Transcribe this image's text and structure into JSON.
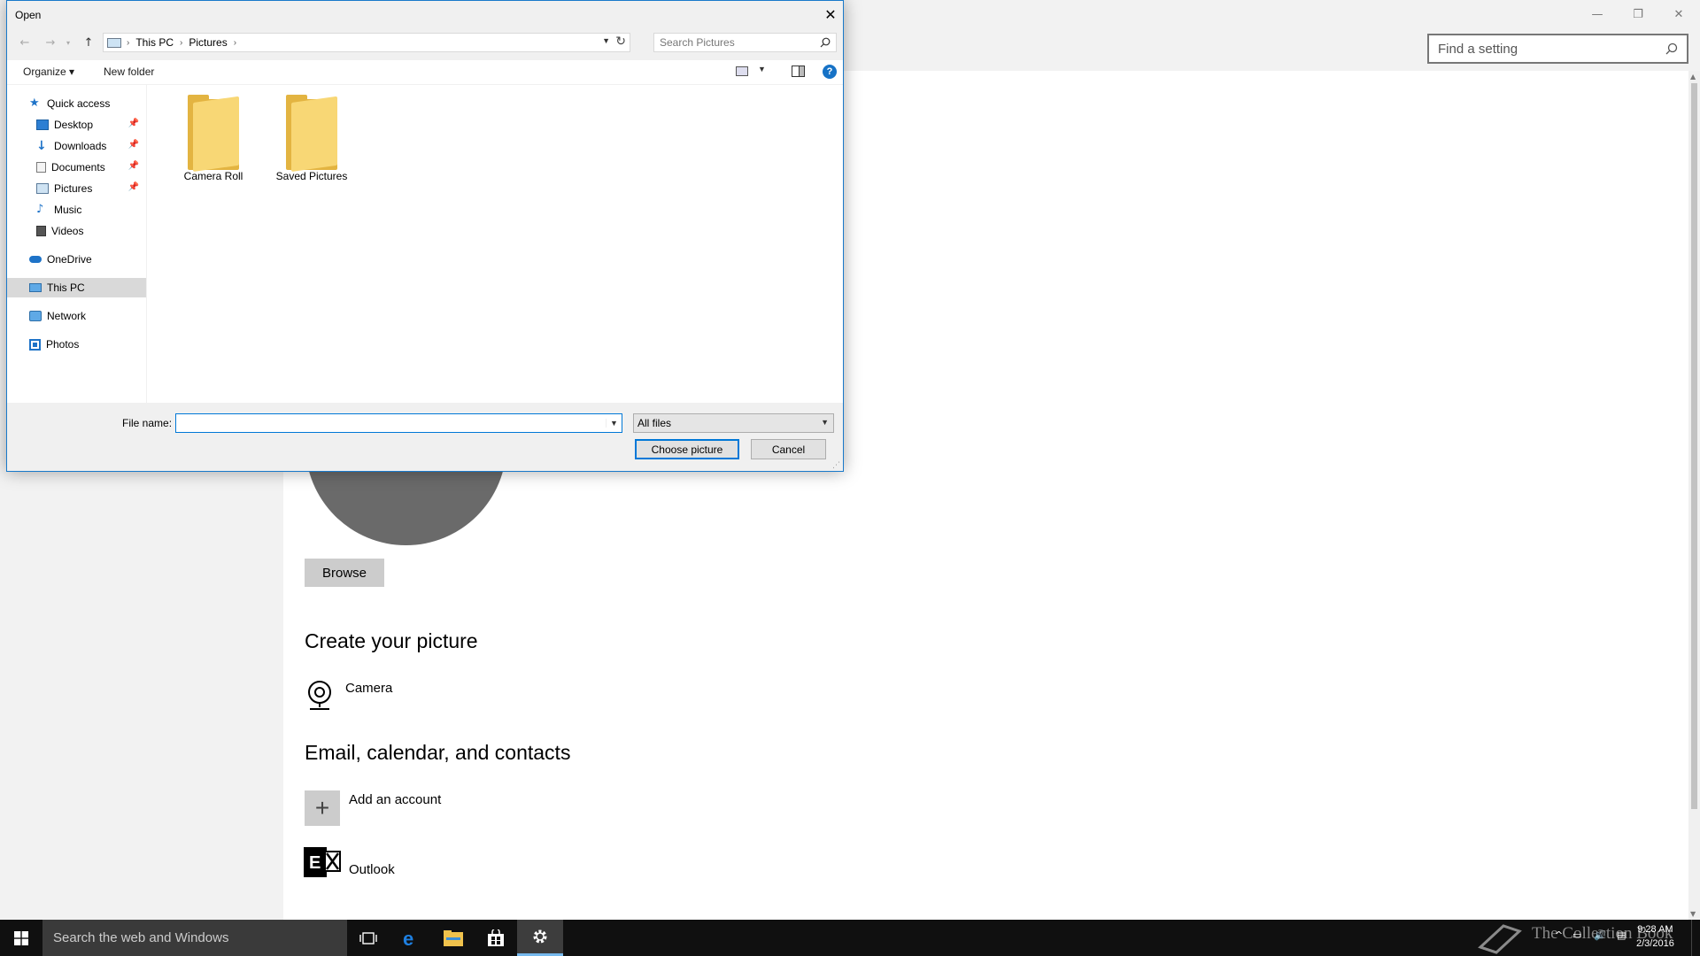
{
  "settings": {
    "search_placeholder": "Find a setting",
    "window_controls": {
      "minimize": "—",
      "restore": "❐",
      "close": "✕"
    },
    "browse_label": "Browse",
    "create_picture_heading": "Create your picture",
    "camera_label": "Camera",
    "accounts_heading": "Email, calendar, and contacts",
    "add_account_label": "Add an account",
    "outlook_label": "Outlook"
  },
  "dialog": {
    "title": "Open",
    "close_glyph": "✕",
    "address": {
      "crumbs": [
        "This PC",
        "Pictures"
      ]
    },
    "search_placeholder": "Search Pictures",
    "toolbar": {
      "organize": "Organize ▾",
      "new_folder": "New folder"
    },
    "nav": {
      "quick_access": "Quick access",
      "items": [
        {
          "label": "Desktop",
          "pinned": true
        },
        {
          "label": "Downloads",
          "pinned": true
        },
        {
          "label": "Documents",
          "pinned": true
        },
        {
          "label": "Pictures",
          "pinned": true
        },
        {
          "label": "Music",
          "pinned": false
        },
        {
          "label": "Videos",
          "pinned": false
        }
      ],
      "onedrive": "OneDrive",
      "this_pc": "This PC",
      "network": "Network",
      "photos": "Photos"
    },
    "folders": [
      "Camera Roll",
      "Saved Pictures"
    ],
    "file_name_label": "File name:",
    "file_name_value": "",
    "filter_value": "All files",
    "choose_label": "Choose picture",
    "cancel_label": "Cancel"
  },
  "taskbar": {
    "search_placeholder": "Search the web and Windows",
    "apps": [
      "task-view-icon",
      "edge-icon",
      "file-explorer-icon",
      "store-icon",
      "settings-gear-icon"
    ],
    "watermark": "The Collection Book",
    "time": "9:28 AM",
    "date": "2/3/2016"
  },
  "colors": {
    "accent": "#0078d7",
    "taskbar": "#101010",
    "folder": "#f8d775",
    "avatar": "#6a6a6a"
  }
}
